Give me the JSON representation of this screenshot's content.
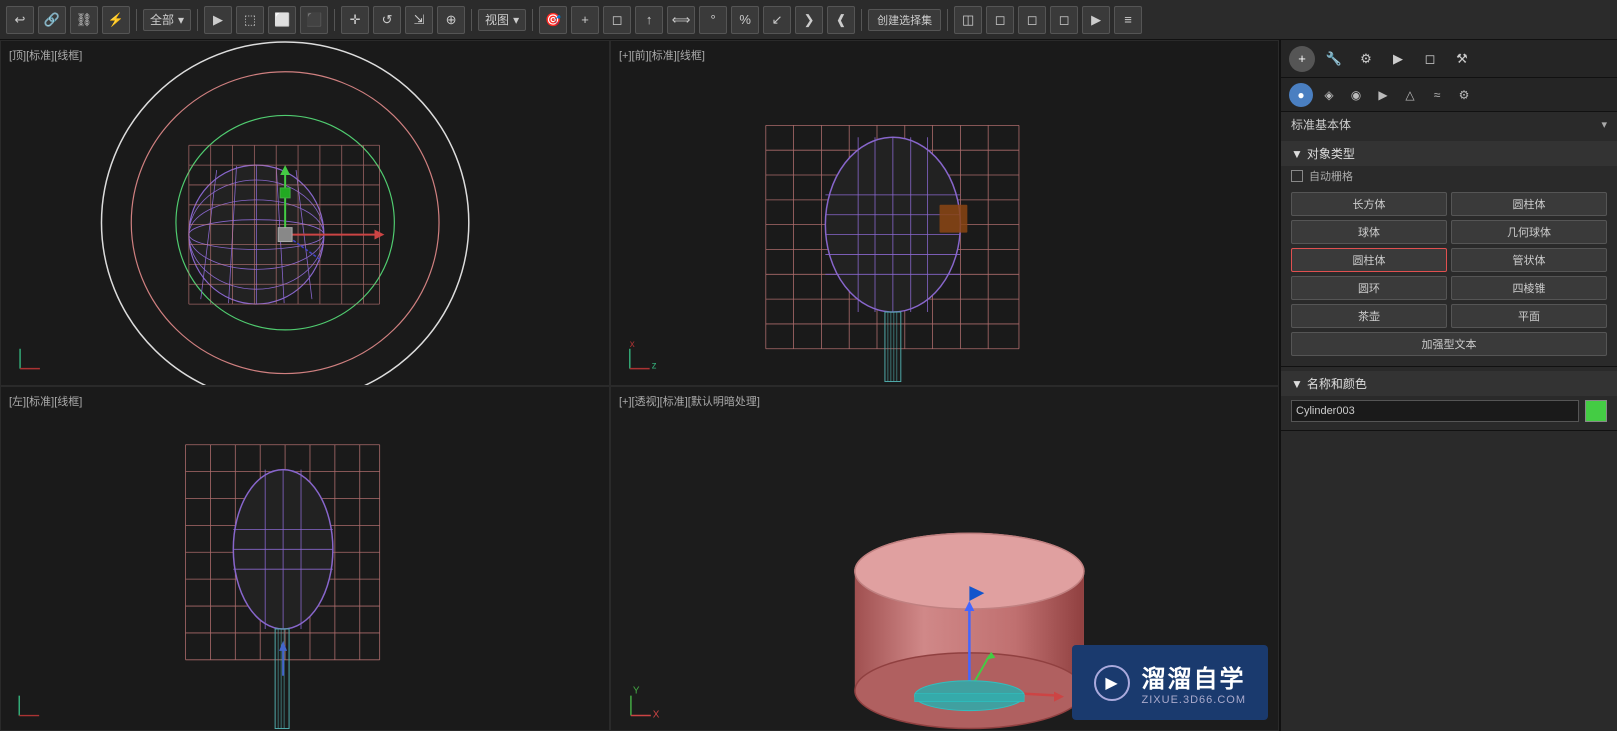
{
  "toolbar": {
    "dropdown_all": "全部",
    "view_label": "视图",
    "create_selection_set": "创建选择集",
    "icons": [
      "↩",
      "⊕",
      "⊗",
      "≈",
      "◻",
      "≡",
      "⬚",
      "⬜",
      "✛",
      "◆",
      "↺",
      "◫",
      "↻",
      "3",
      "↗",
      "⁰⁄",
      "↙",
      "◌",
      "❴❵",
      "+",
      "◻",
      "↑",
      "3°",
      "∠",
      "%",
      "↙",
      "❯❮"
    ]
  },
  "viewport_top": {
    "label": "[顶][标准][线框]"
  },
  "viewport_front": {
    "label": "[+][前][标准][线框]"
  },
  "viewport_left": {
    "label": "[左][标准][线框]"
  },
  "viewport_persp": {
    "label": "[+][透视][标准][默认明暗处理]"
  },
  "right_panel": {
    "section_object_type": "对象类型",
    "auto_grid": "自动栅格",
    "btn_box": "长方体",
    "btn_cylinder": "圆柱体",
    "btn_sphere": "球体",
    "btn_geo_sphere": "几何球体",
    "btn_cyl_active": "圆柱体",
    "btn_tube": "管状体",
    "btn_torus": "圆环",
    "btn_cone": "四棱锥",
    "btn_teapot": "茶壶",
    "btn_plane": "平面",
    "btn_text": "加强型文本",
    "section_name_color": "名称和颜色",
    "object_name": "Cylinder003",
    "type_header": "标准基本体",
    "top_icons": [
      "●",
      "◈",
      "◉",
      "▶",
      "△",
      "≈",
      "◎"
    ],
    "top_icons2": [
      "+",
      "◱",
      "◱",
      "●",
      "▬",
      "⌐",
      "↗",
      "≈",
      "◎"
    ]
  },
  "watermark": {
    "site": "溜溜自学",
    "url": "ZIXUE.3D66.COM"
  }
}
